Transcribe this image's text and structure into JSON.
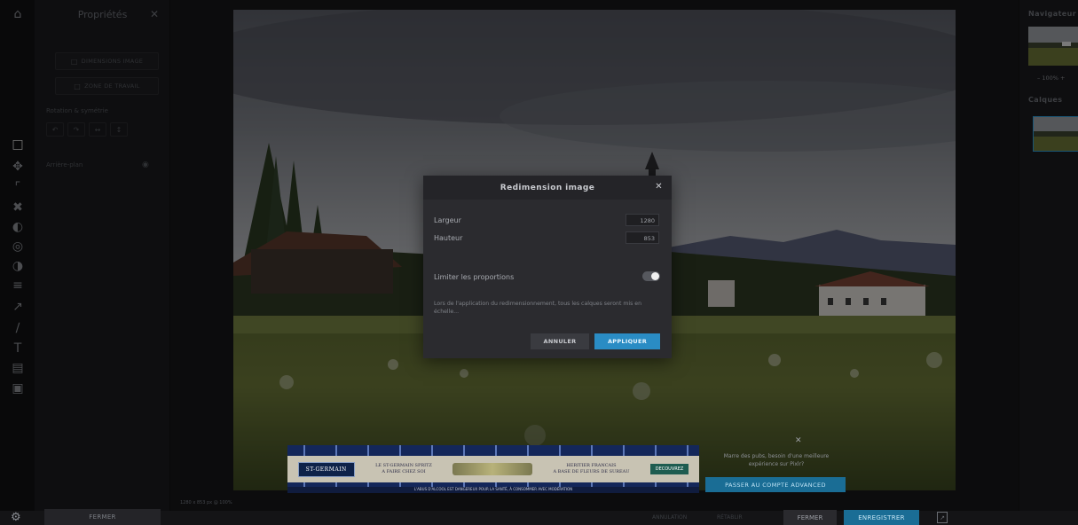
{
  "properties_panel": {
    "title": "Propriétés",
    "image_size_label": "DIMENSIONS IMAGE",
    "workspace_label": "ZONE DE TRAVAIL",
    "rotation_label": "Rotation & symétrie",
    "background_label": "Arrière-plan",
    "close_label": "FERMER"
  },
  "tools": [
    "edit-icon",
    "move-icon",
    "crop-icon",
    "cut-icon",
    "adjust-icon",
    "filter-icon",
    "effect-icon",
    "liquify-icon",
    "brush-icon",
    "pen-icon",
    "text-icon",
    "frame-icon",
    "image-icon"
  ],
  "right_panel": {
    "navigator_title": "Navigateur",
    "zoom_value": "100%",
    "layers_title": "Calques"
  },
  "dialog": {
    "title": "Redimension image",
    "width_label": "Largeur",
    "width_value": "1280",
    "height_label": "Hauteur",
    "height_value": "853",
    "constrain_label": "Limiter les proportions",
    "constrain_on": true,
    "note": "Lors de l'application du redimensionnement, tous les calques seront mis en échelle...",
    "cancel_label": "ANNULER",
    "apply_label": "APPLIQUER"
  },
  "ad": {
    "brand": "ST-GERMAIN",
    "text1": "LE ST-GERMAIN SPRITZ\nA FAIRE CHEZ SOI",
    "text2": "HERITIER FRANCAIS\nA BASE DE FLEURS DE SUREAU",
    "cta": "DECOUVREZ",
    "footer": "L'ABUS D'ALCOOL EST DANGEREUX POUR LA SANTÉ, À CONSOMMER AVEC MODÉRATION"
  },
  "promo": {
    "text": "Marre des pubs, besoin d'une meilleure expérience sur Pixlr?",
    "button": "PASSER AU COMPTE ADVANCED"
  },
  "status": {
    "info": "1280 x 853 px @ 100%"
  },
  "bottom_bar": {
    "undo_label": "ANNULATION",
    "redo_label": "RÉTABLIR",
    "close_label": "FERMER",
    "save_label": "ENREGISTRER"
  }
}
